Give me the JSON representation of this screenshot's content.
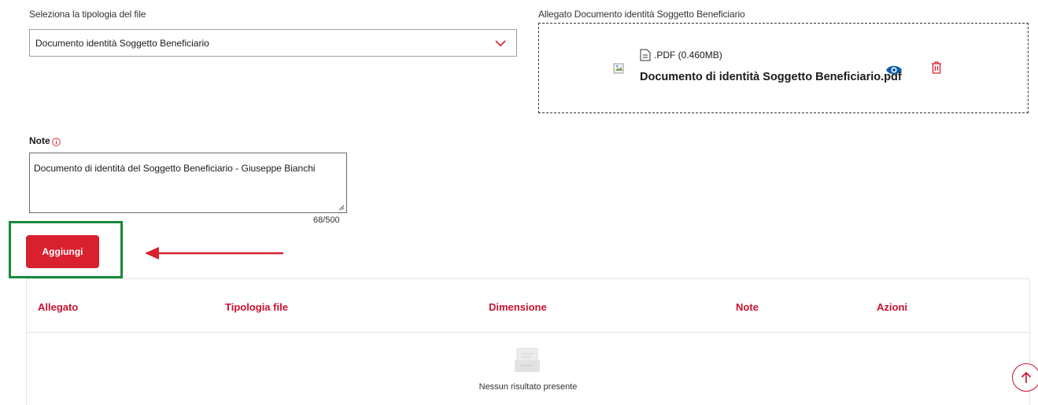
{
  "form": {
    "select_label": "Seleziona la tipologia del file",
    "select_value": "Documento identità Soggetto Beneficiario",
    "attachment_label": "Allegato Documento identità Soggetto Beneficiario"
  },
  "attachment": {
    "file_meta": ".PDF (0.460MB)",
    "file_name": "Documento di identità Soggetto Beneficiario.pdf"
  },
  "note": {
    "label": "Note",
    "value": "Documento di identità del Soggetto Beneficiario - Giuseppe Bianchi",
    "char_count": "68/500"
  },
  "actions": {
    "add_label": "Aggiungi"
  },
  "table": {
    "headers": [
      "Allegato",
      "Tipologia file",
      "Dimensione",
      "Note",
      "Azioni"
    ],
    "empty_message": "Nessun risultato presente"
  },
  "colors": {
    "accent_red": "#d9202e",
    "header_red": "#c8102e",
    "highlight_green": "#1a8a3e",
    "eye_blue": "#0b5ea8"
  },
  "icons": [
    "chevron-down-icon",
    "broken-image-icon",
    "file-icon",
    "eye-icon",
    "trash-icon",
    "info-icon",
    "resize-grip-icon",
    "arrow-left-icon",
    "empty-inbox-icon",
    "arrow-up-icon"
  ]
}
